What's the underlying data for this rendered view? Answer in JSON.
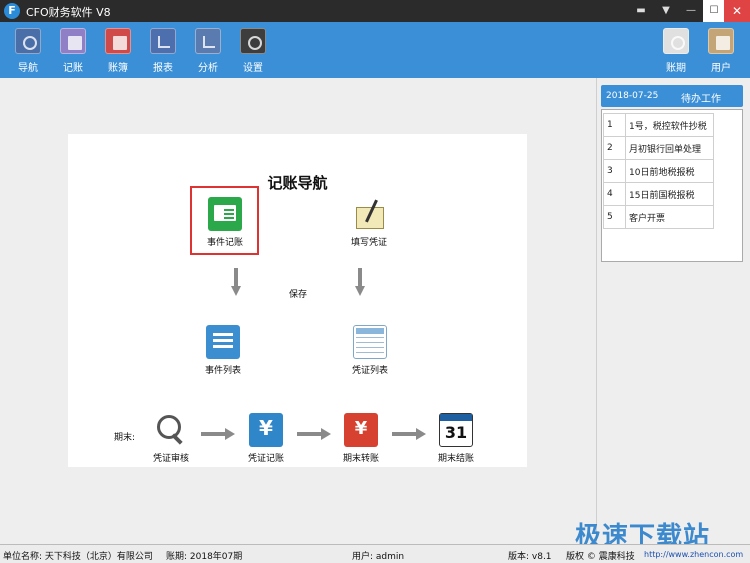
{
  "window": {
    "title": "CFO财务软件 V8",
    "logo_letter": "F",
    "controls": [
      "▬",
      "▼",
      "—",
      "☐",
      "✕"
    ]
  },
  "toolbar": {
    "left": [
      {
        "label": "导航",
        "icon": "compass-icon"
      },
      {
        "label": "记账",
        "icon": "pencil-icon"
      },
      {
        "label": "账簿",
        "icon": "book-icon"
      },
      {
        "label": "报表",
        "icon": "chart-icon"
      },
      {
        "label": "分析",
        "icon": "analysis-icon"
      },
      {
        "label": "设置",
        "icon": "gear-icon"
      }
    ],
    "right": [
      {
        "label": "账期",
        "icon": "clock-icon"
      },
      {
        "label": "用户",
        "icon": "user-icon"
      }
    ]
  },
  "nav": {
    "title": "记账导航",
    "event_entry": "事件记账",
    "fill_voucher": "填写凭证",
    "save": "保存",
    "event_list": "事件列表",
    "voucher_list": "凭证列表",
    "period_end": "期末:",
    "voucher_review": "凭证审核",
    "voucher_post": "凭证记账",
    "period_transfer": "期末转账",
    "period_close": "期末结账"
  },
  "todo": {
    "date": "2018-07-25",
    "title": "待办工作",
    "items": [
      {
        "no": "1",
        "text": "1号，税控软件抄税"
      },
      {
        "no": "2",
        "text": "月初银行回单处理"
      },
      {
        "no": "3",
        "text": "10日前地税报税"
      },
      {
        "no": "4",
        "text": "15日前国税报税"
      },
      {
        "no": "5",
        "text": "客户开票"
      }
    ]
  },
  "status": {
    "unit": "单位名称: 天下科技（北京）有限公司",
    "period": "账期: 2018年07期",
    "user": "用户: admin",
    "version": "版本: v8.1",
    "copyright": "版权 © 震康科技",
    "url": "http://www.zhencon.com"
  },
  "watermark": "极速下载站"
}
